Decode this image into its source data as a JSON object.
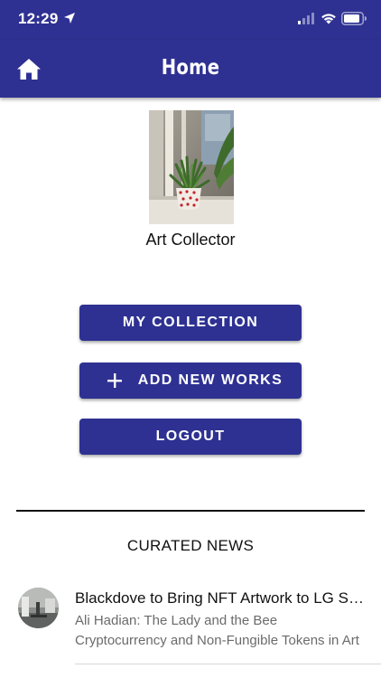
{
  "status_bar": {
    "time": "12:29",
    "icons": [
      "location-arrow-icon",
      "cellular-signal-icon",
      "wifi-icon",
      "battery-icon"
    ]
  },
  "app_bar": {
    "title": "Home",
    "home_icon": "home-icon",
    "color": "#2e3192"
  },
  "profile": {
    "name": "Art Collector"
  },
  "actions": {
    "my_collection": "MY COLLECTION",
    "add_new_works": "ADD NEW WORKS",
    "add_icon": "plus-icon",
    "logout": "LOGOUT"
  },
  "news": {
    "heading": "CURATED NEWS",
    "items": [
      {
        "title": "Blackdove to Bring NFT Artwork to LG Smart TVs",
        "subtitle1": "Ali Hadian: The Lady and the Bee",
        "subtitle2": "Cryptocurrency and Non-Fungible Tokens in Art"
      }
    ]
  }
}
